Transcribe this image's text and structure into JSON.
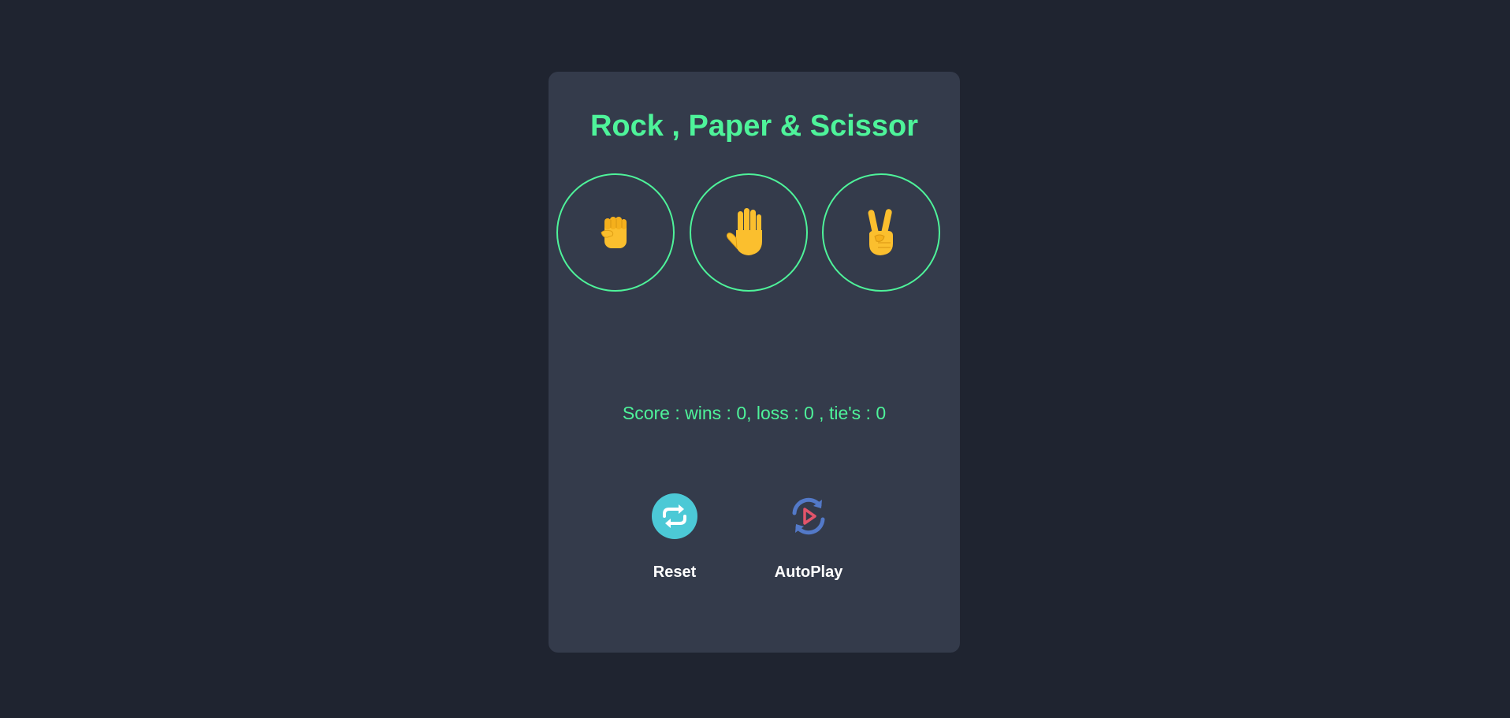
{
  "game": {
    "title": "Rock , Paper & Scissor",
    "choices": [
      {
        "name": "rock",
        "icon": "raised-fist-icon"
      },
      {
        "name": "paper",
        "icon": "raised-hand-icon"
      },
      {
        "name": "scissors",
        "icon": "victory-hand-icon"
      }
    ],
    "score": {
      "prefix": "Score : wins : ",
      "wins": "0",
      "loss_label": ", loss : ",
      "loss": "0",
      "ties_label": " , tie's : ",
      "ties": "0"
    }
  },
  "actions": {
    "reset_label": "Reset",
    "reset_icon": "reset-arrows-icon",
    "autoplay_label": "AutoPlay",
    "autoplay_icon": "autoplay-icon"
  },
  "colors": {
    "background": "#1f2430",
    "card": "#343b4b",
    "accent": "#4ef39a",
    "emoji": "#fbbf2e",
    "reset_circle": "#4cc9d6",
    "autoplay_ring": "#5379c8",
    "autoplay_play": "#e2546a"
  }
}
